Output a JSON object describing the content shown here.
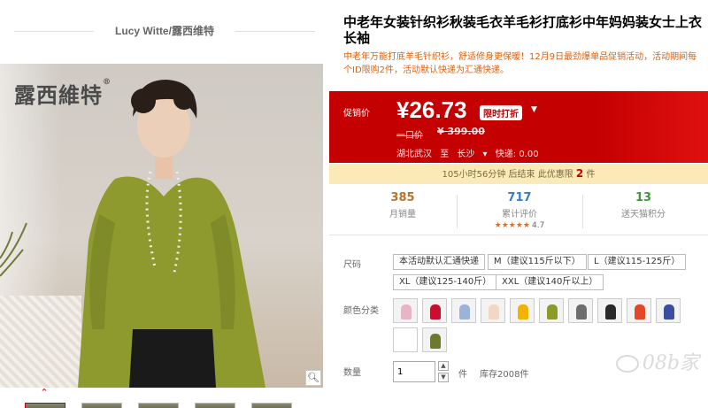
{
  "store": {
    "title": "Lucy Witte/露西维特",
    "brand_logo": "露西維特",
    "brand_mark": "®"
  },
  "gallery": {
    "zoom_icon": "zoom-icon",
    "up_arrow": "⌃"
  },
  "product": {
    "title": "中老年女装针织衫秋装毛衣羊毛衫打底衫中年妈妈装女士上衣长袖",
    "subtitle": "中老年万能打底羊毛针织衫，舒适修身更保暖！12月9日最劲爆单品促销活动，活动期间每个ID限购2件，活动默认快递为汇通快递。"
  },
  "price": {
    "label": "促销价",
    "current": "¥26.73",
    "badge": "限时打折",
    "original_label": "一口价",
    "original": "¥ 399.00",
    "origin": "湖北武汉",
    "to": "至",
    "destination": "长沙",
    "shipping": "快递: 0.00"
  },
  "timer": {
    "text_before": "105小时56分钟 后结束   此优惠限 ",
    "limit": "2",
    "text_after": " 件"
  },
  "stats": {
    "sales_num": "385",
    "sales_label": "月销量",
    "reviews_num": "717",
    "reviews_label": "累计评价",
    "rating": "4.7",
    "points_num": "13",
    "points_label": "送天猫积分"
  },
  "options": {
    "size_label": "尺码",
    "sizes": [
      "本活动默认汇通快递",
      "M（建议115斤以下）",
      "L（建议115-125斤）",
      "XL（建议125-140斤）",
      "XXL（建议140斤以上）"
    ],
    "color_label": "颜色分类",
    "colors": [
      "#e9b3c8",
      "#c8102e",
      "#9bb3d6",
      "#f2d7c4",
      "#f0b400",
      "#8c9a2a",
      "#6d6d6d",
      "#2a2a2a",
      "#e4462a",
      "#3b4fa0",
      "#ffffff",
      "#6b7a2c"
    ]
  },
  "quantity": {
    "label": "数量",
    "value": "1",
    "unit": "件",
    "stock": "库存2008件"
  },
  "watermark": "08b家"
}
